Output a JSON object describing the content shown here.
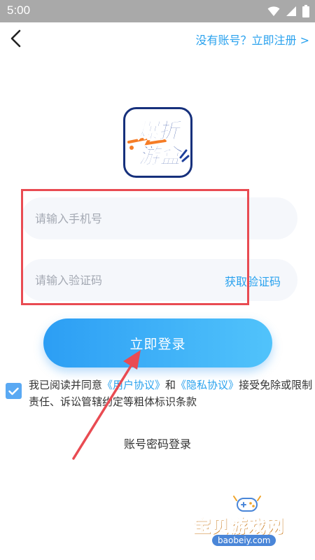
{
  "status_bar": {
    "time": "5:00"
  },
  "header": {
    "register_link": "没有账号？立即注册 >"
  },
  "logo": {
    "line1": "爆折",
    "line2": "游盒"
  },
  "form": {
    "phone_placeholder": "请输入手机号",
    "code_placeholder": "请输入验证码",
    "get_code_label": "获取验证码"
  },
  "login_button": "立即登录",
  "agreement": {
    "checked": true,
    "prefix": "我已阅读并同意",
    "user_agreement": "《用户协议》",
    "and": "和",
    "privacy_agreement": "《隐私协议》",
    "suffix": "接受免除或限制责任、诉讼管辖约定等粗体标识条款"
  },
  "password_login": "账号密码登录",
  "watermark": {
    "text": "宝贝游戏网",
    "url": "baobeiy.com"
  },
  "colors": {
    "accent": "#2aa2ee",
    "highlight": "#e94b52",
    "status_bar": "#a9a9a9"
  }
}
